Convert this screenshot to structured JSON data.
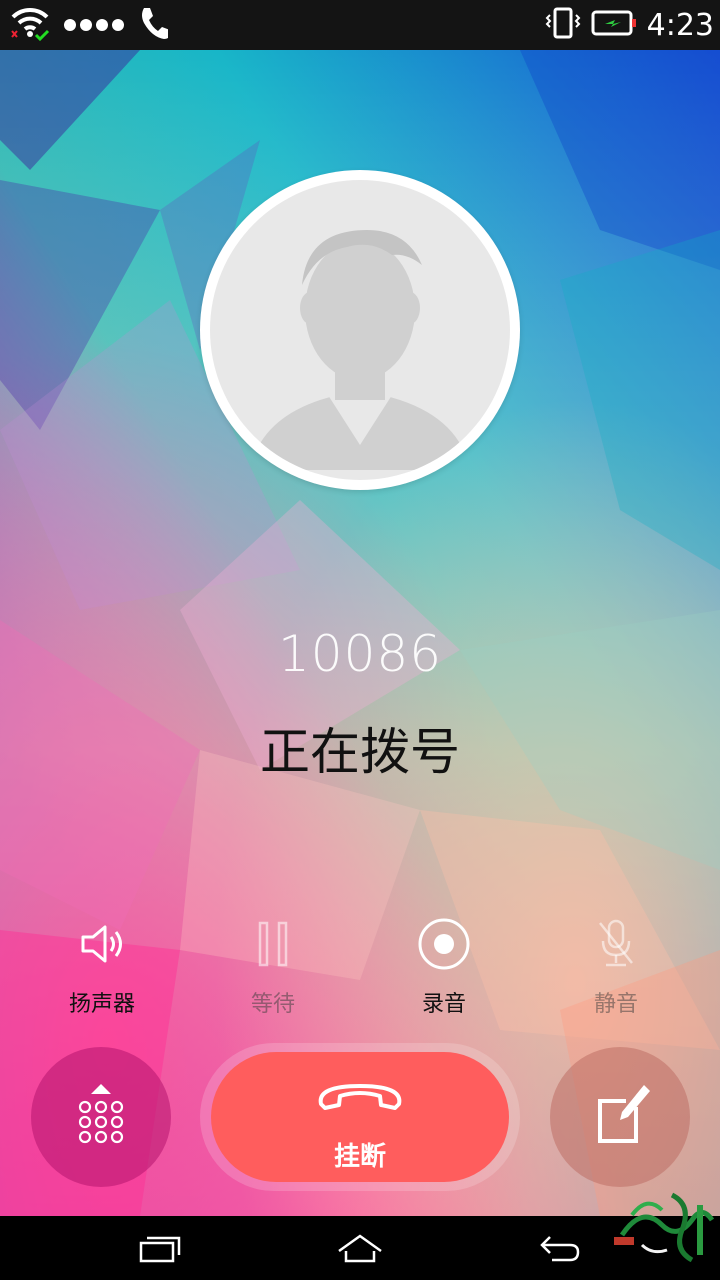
{
  "status_bar": {
    "time": "4:23",
    "icons": [
      "wifi-icon",
      "signal-dots-icon",
      "phone-icon",
      "vibrate-icon",
      "battery-charging-icon"
    ]
  },
  "call": {
    "number": "10086",
    "status": "正在拨号"
  },
  "actions": [
    {
      "label": "扬声器",
      "icon": "speaker-icon",
      "enabled": true
    },
    {
      "label": "等待",
      "icon": "pause-icon",
      "enabled": false
    },
    {
      "label": "录音",
      "icon": "record-icon",
      "enabled": true
    },
    {
      "label": "静音",
      "icon": "mic-mute-icon",
      "enabled": false
    }
  ],
  "bottom": {
    "hangup_label": "挂断",
    "keypad_icon": "keypad-icon",
    "note_icon": "edit-note-icon"
  },
  "navbar": {
    "icons": [
      "recent-apps-icon",
      "home-icon",
      "back-icon"
    ]
  },
  "colors": {
    "hangup": "#ff5d5d",
    "status_bar": "#141414"
  }
}
